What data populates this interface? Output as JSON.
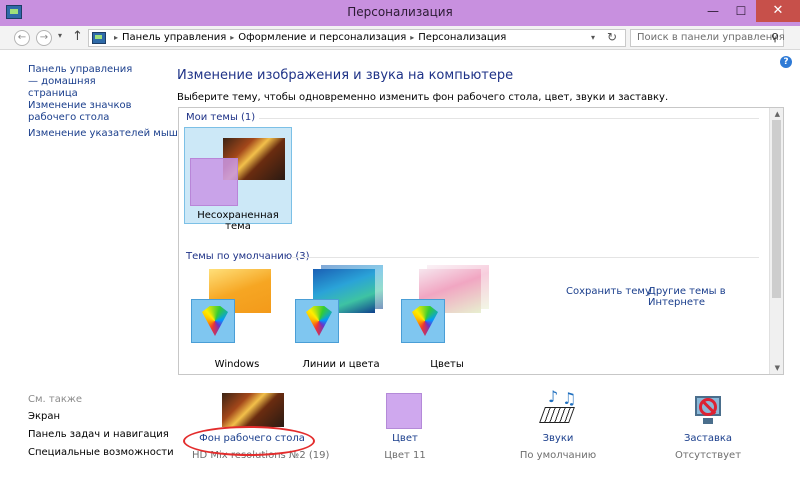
{
  "window": {
    "title": "Персонализация",
    "min_glyph": "—",
    "max_glyph": "☐",
    "close_glyph": "✕"
  },
  "address_bar": {
    "back_glyph": "←",
    "forward_glyph": "→",
    "up_glyph": "↑",
    "breadcrumb": [
      "Панель управления",
      "Оформление и персонализация",
      "Персонализация"
    ],
    "search_placeholder": "Поиск в панели управления"
  },
  "sidebar": {
    "links": [
      "Панель управления — домашняя страница",
      "Изменение значков рабочего стола",
      "Изменение указателей мыши"
    ],
    "see_also_heading": "См. также",
    "see_also": [
      "Экран",
      "Панель задач и навигация",
      "Специальные возможности"
    ]
  },
  "main": {
    "title": "Изменение изображения и звука на компьютере",
    "subtitle": "Выберите тему, чтобы одновременно изменить фон рабочего стола, цвет, звуки и заставку.",
    "my_themes_heading": "Мои темы (1)",
    "my_theme_label": "Несохраненная тема",
    "save_theme_link": "Сохранить тему",
    "more_themes_link": "Другие темы в Интернете",
    "default_themes_heading": "Темы по умолчанию (3)",
    "default_themes": [
      "Windows",
      "Линии и цвета",
      "Цветы"
    ]
  },
  "bottom_bar": {
    "items": [
      {
        "title": "Фон рабочего стола",
        "value": "HD Mix resolutions №2 (19)"
      },
      {
        "title": "Цвет",
        "value": "Цвет 11"
      },
      {
        "title": "Звуки",
        "value": "По умолчанию"
      },
      {
        "title": "Заставка",
        "value": "Отсутствует"
      }
    ]
  },
  "colors": {
    "title_bar": "#c890df",
    "close_button": "#c7504a",
    "link": "#1a3e8c",
    "heading": "#1e3287",
    "selection": "#cce8f7",
    "annotation_oval": "#e32c2c"
  },
  "icons": [
    "control-panel-icon",
    "help-icon",
    "search-icon",
    "refresh-icon",
    "color-fan-icon",
    "sounds-icon",
    "screensaver-icon"
  ]
}
